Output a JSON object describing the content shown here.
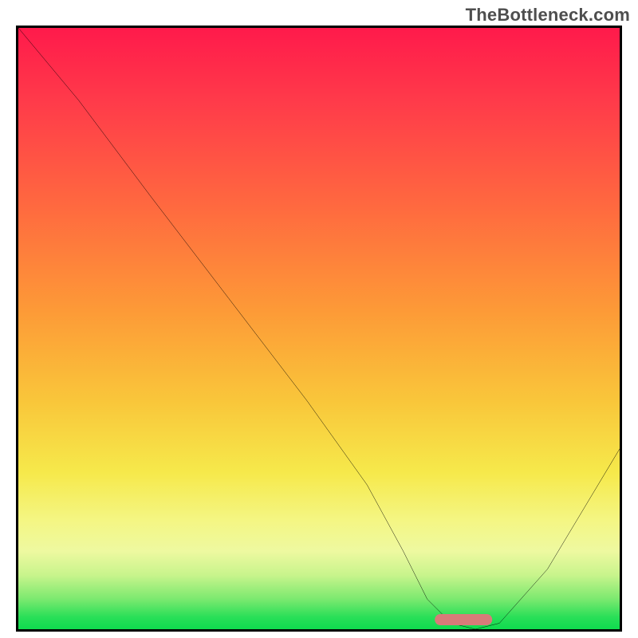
{
  "watermark": "TheBottleneck.com",
  "chart_data": {
    "type": "line",
    "title": "",
    "xlabel": "",
    "ylabel": "",
    "xlim": [
      0,
      100
    ],
    "ylim": [
      0,
      100
    ],
    "grid": false,
    "series": [
      {
        "name": "curve",
        "x": [
          0,
          10,
          22,
          35,
          48,
          58,
          64,
          68,
          72,
          76,
          80,
          88,
          100
        ],
        "values": [
          100,
          88,
          72,
          55,
          38,
          24,
          13,
          5,
          1,
          0,
          1,
          10,
          30
        ]
      }
    ],
    "marker": {
      "x_center_pct": 74,
      "width_pct": 9.5,
      "y_from_bottom_pct": 0.6
    },
    "background_gradient": {
      "top": "#ff1a4b",
      "mid": "#f6e94b",
      "bottom": "#0fdc4e"
    }
  }
}
